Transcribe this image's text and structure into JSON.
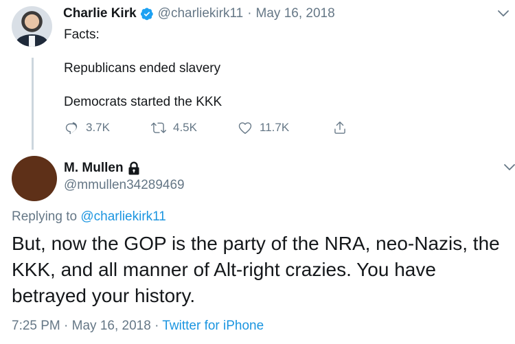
{
  "original_tweet": {
    "author_name": "Charlie Kirk",
    "handle": "@charliekirk11",
    "separator": "·",
    "date": "May 16, 2018",
    "lines": [
      "Facts:",
      "Republicans ended slavery",
      "Democrats started the KKK"
    ],
    "actions": {
      "replies": "3.7K",
      "retweets": "4.5K",
      "likes": "11.7K"
    }
  },
  "reply_tweet": {
    "author_name": "M. Mullen",
    "handle": "@mmullen34289469",
    "replying_prefix": "Replying to",
    "replying_to": "@charliekirk11",
    "text": "But, now the GOP is the party of the NRA, neo-Nazis, the KKK, and all manner of Alt-right crazies.  You have betrayed your history.",
    "time": "7:25 PM",
    "separator": "·",
    "date": "May 16, 2018",
    "source": "Twitter for iPhone"
  },
  "colors": {
    "text": "#14171a",
    "secondary": "#657786",
    "link": "#1b95e0",
    "verified": "#1da1f2",
    "thread_line": "#ccd6dd",
    "reply_avatar": "#5e3018"
  }
}
